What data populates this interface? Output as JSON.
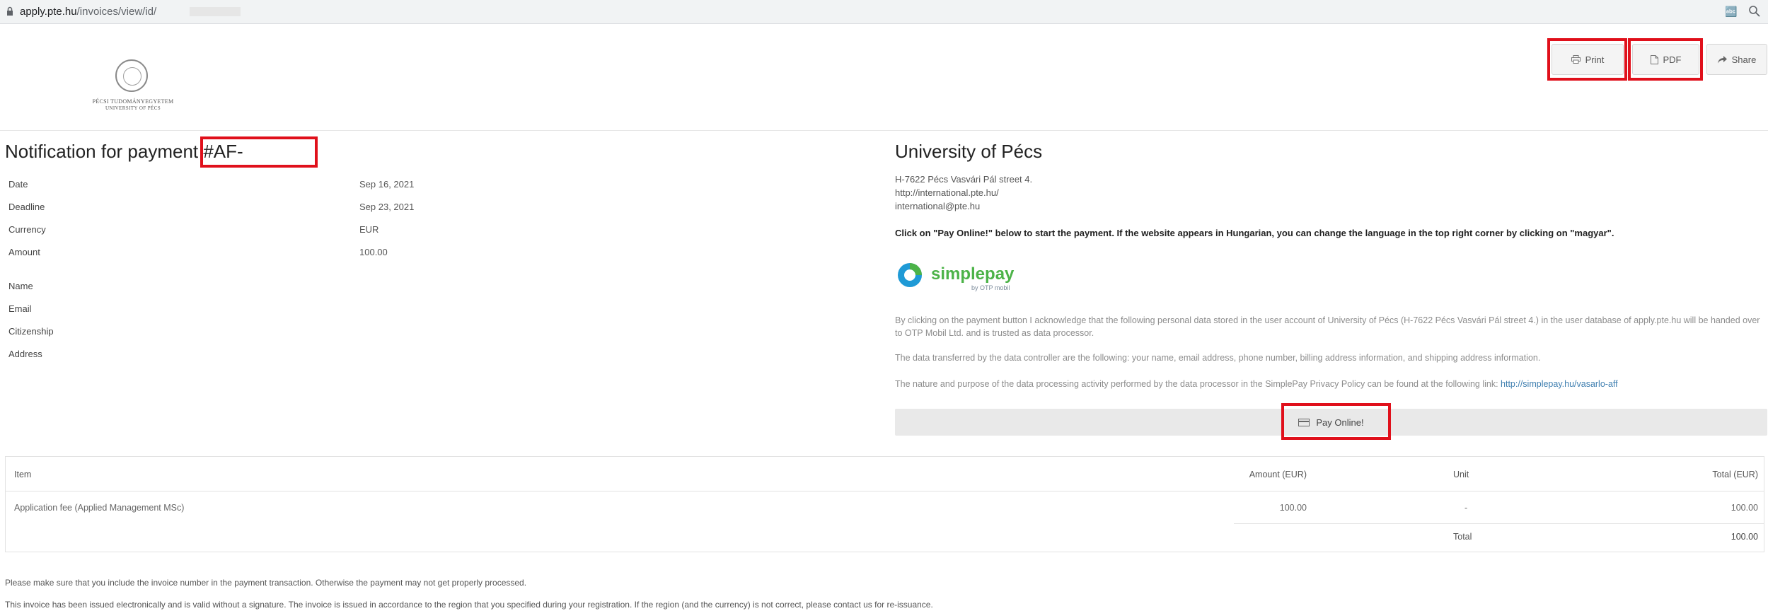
{
  "browser": {
    "url_host": "apply.pte.hu",
    "url_path": "/invoices/view/id/"
  },
  "toolbar": {
    "print_label": "Print",
    "pdf_label": "PDF",
    "share_label": "Share"
  },
  "logo": {
    "line1": "PÉCSI TUDOMÁNYEGYETEM",
    "line2": "UNIVERSITY OF PÉCS"
  },
  "invoice": {
    "title": "Notification for payment #AF-",
    "fields": [
      {
        "label": "Date",
        "value": "Sep 16, 2021"
      },
      {
        "label": "Deadline",
        "value": "Sep 23, 2021"
      },
      {
        "label": "Currency",
        "value": "EUR"
      },
      {
        "label": "Amount",
        "value": "100.00"
      },
      {
        "label": "Name",
        "value": ""
      },
      {
        "label": "Email",
        "value": ""
      },
      {
        "label": "Citizenship",
        "value": ""
      },
      {
        "label": "Address",
        "value": ""
      }
    ]
  },
  "issuer": {
    "name": "University of Pécs",
    "address_lines": [
      "H-7622 Pécs Vasvári Pál street 4.",
      "http://international.pte.hu/",
      "international@pte.hu"
    ],
    "instruction": "Click on \"Pay Online!\" below to start the payment. If the website appears in Hungarian, you can change the language in the top right corner by clicking on \"magyar\"."
  },
  "simplepay": {
    "name": "simplepay",
    "by": "by OTP mobil",
    "para1": "By clicking on the payment button I acknowledge that the following personal data stored in the user account of University of Pécs (H-7622 Pécs Vasvári Pál street 4.) in the user database of apply.pte.hu will be handed over to OTP Mobil Ltd. and is trusted as data processor.",
    "para2": "The data transferred by the data controller are the following: your name, email address, phone number, billing address information, and shipping address information.",
    "para3_text": "The nature and purpose of the data processing activity performed by the data processor in the SimplePay Privacy Policy can be found at the following link: ",
    "para3_link": "http://simplepay.hu/vasarlo-aff",
    "pay_label": "Pay Online!"
  },
  "table": {
    "headers": {
      "item": "Item",
      "amount": "Amount (EUR)",
      "unit": "Unit",
      "total": "Total (EUR)"
    },
    "rows": [
      {
        "item": "Application fee (Applied Management MSc)",
        "amount": "100.00",
        "unit": "-",
        "total": "100.00"
      }
    ],
    "total_label": "Total",
    "total_value": "100.00"
  },
  "footer": {
    "note1": "Please make sure that you include the invoice number in the payment transaction. Otherwise the payment may not get properly processed.",
    "note2": "This invoice has been issued electronically and is valid without a signature. The invoice is issued in accordance to the region that you specified during your registration. If the region (and the currency) is not correct, please contact us for re-issuance."
  },
  "colors": {
    "highlight": "#e0101b",
    "simplepay_green": "#4cb348",
    "simplepay_blue": "#1f9ad6",
    "link": "#3f7fb0"
  }
}
